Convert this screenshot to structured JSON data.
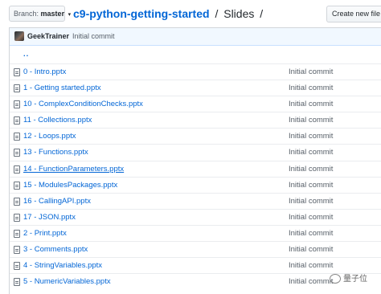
{
  "toolbar": {
    "branch_prefix": "Branch:",
    "branch_name": "master",
    "repo_name": "c9-python-getting-started",
    "separator": "/",
    "folder_name": "Slides",
    "trailing_separator": "/",
    "create_file_label": "Create new file"
  },
  "commit": {
    "author": "GeekTrainer",
    "message": "Initial commit"
  },
  "up_link": "..",
  "files": [
    {
      "name": "0 - Intro.pptx",
      "message": "Initial commit"
    },
    {
      "name": "1 - Getting started.pptx",
      "message": "Initial commit"
    },
    {
      "name": "10 - ComplexConditionChecks.pptx",
      "message": "Initial commit"
    },
    {
      "name": "11 - Collections.pptx",
      "message": "Initial commit"
    },
    {
      "name": "12 - Loops.pptx",
      "message": "Initial commit"
    },
    {
      "name": "13 - Functions.pptx",
      "message": "Initial commit"
    },
    {
      "name": "14 - FunctionParameters.pptx",
      "message": "Initial commit"
    },
    {
      "name": "15 - ModulesPackages.pptx",
      "message": "Initial commit"
    },
    {
      "name": "16 - CallingAPI.pptx",
      "message": "Initial commit"
    },
    {
      "name": "17 - JSON.pptx",
      "message": "Initial commit"
    },
    {
      "name": "2 - Print.pptx",
      "message": "Initial commit"
    },
    {
      "name": "3 - Comments.pptx",
      "message": "Initial commit"
    },
    {
      "name": "4 - StringVariables.pptx",
      "message": "Initial commit"
    },
    {
      "name": "5 - NumericVariables.pptx",
      "message": "Initial commit"
    }
  ],
  "hovered_file": "14 - FunctionParameters.pptx",
  "watermark": "量子位",
  "icons": {
    "file": "file-icon",
    "caret": "caret-down-icon",
    "avatar": "avatar",
    "watermark": "wechat-icon"
  }
}
